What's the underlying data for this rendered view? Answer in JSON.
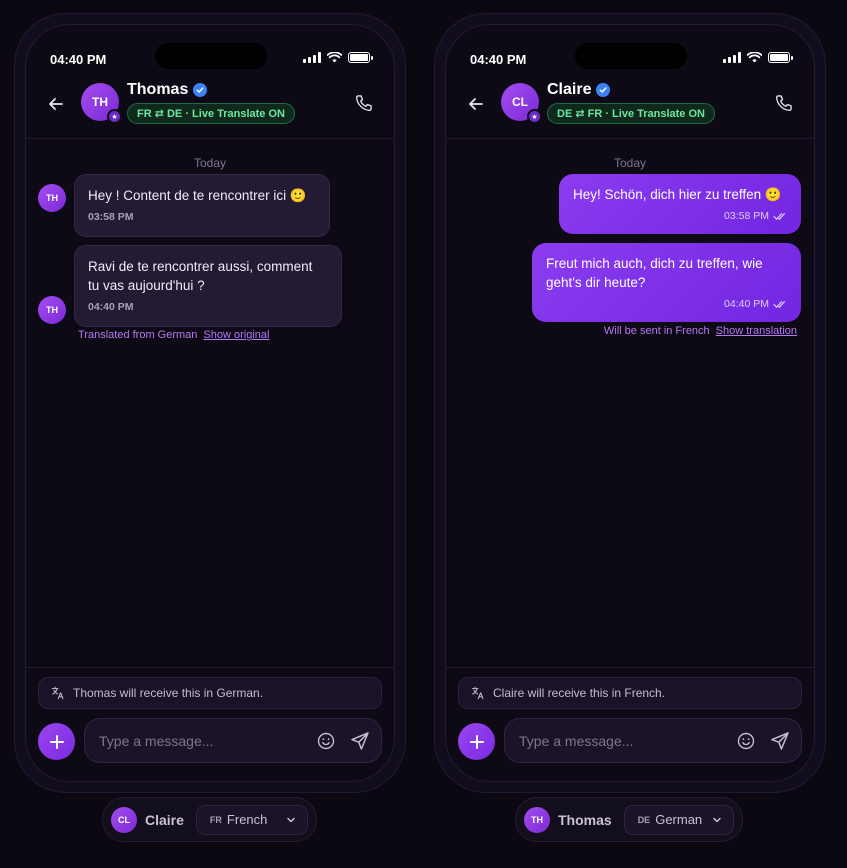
{
  "status": {
    "time": "04:40 PM"
  },
  "phones": {
    "left": {
      "contact": {
        "name": "Thomas",
        "initials": "TH"
      },
      "live_pill": "FR ⇄ DE · Live Translate ON",
      "day_label": "Today",
      "messages": [
        {
          "text": "Hey ! Content de te rencontrer ici 🙂",
          "time": "03:58 PM"
        },
        {
          "text_line1": "Ravi de te rencontrer aussi, comment",
          "text_line2": "tu vas aujourd'hui ?",
          "time": "04:40 PM"
        }
      ],
      "translate_note": {
        "text": "Translated from German",
        "link": "Show original"
      },
      "receive_hint": "Thomas will receive this in German.",
      "input_placeholder": "Type a message..."
    },
    "right": {
      "contact": {
        "name": "Claire",
        "initials": "CL"
      },
      "live_pill": "DE ⇄ FR · Live Translate ON",
      "day_label": "Today",
      "messages": [
        {
          "text": "Hey! Schön, dich hier zu treffen 🙂",
          "time": "03:58 PM"
        },
        {
          "text_line1": "Freut mich auch, dich zu treffen, wie",
          "text_line2": "geht's dir heute?",
          "time": "04:40 PM"
        }
      ],
      "translate_note": {
        "text": "Will be sent in French",
        "link": "Show translation"
      },
      "receive_hint": "Claire will receive this in French.",
      "input_placeholder": "Type a message..."
    }
  },
  "switchers": {
    "left": {
      "initials": "CL",
      "name": "Claire",
      "lang_code": "FR",
      "lang_name": "French"
    },
    "right": {
      "initials": "TH",
      "name": "Thomas",
      "lang_code": "DE",
      "lang_name": "German"
    }
  },
  "icons": {
    "back": "arrow-left-icon",
    "call": "phone-icon",
    "verified": "verified-check-icon",
    "translate": "translate-icon",
    "plus": "plus-icon",
    "emoji": "emoji-icon",
    "send": "send-icon",
    "chevron": "chevron-down-icon",
    "read_receipt": "double-check-icon"
  },
  "colors": {
    "accent": "#8b3cf0",
    "live_green": "#6ee7a0",
    "verified_blue": "#3b82f6",
    "background": "#0c0812"
  }
}
